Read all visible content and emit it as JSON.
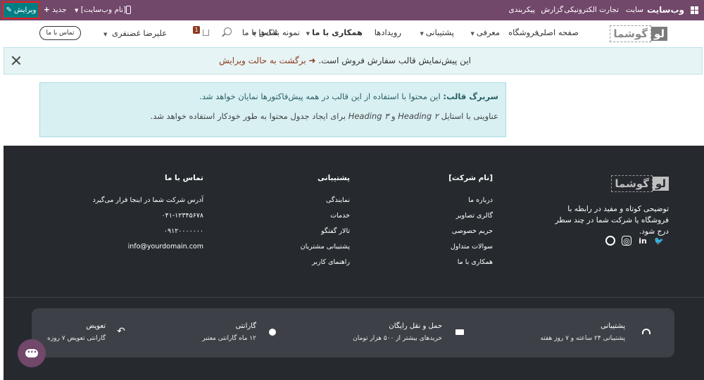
{
  "admin_bar": {
    "brand": "وب‌سایت",
    "menu": [
      "سایت",
      "تجارت الکترونیکی",
      "گزارش",
      "پیکربندی"
    ],
    "edit_label": "ویرایش",
    "new_label": "جدید",
    "site_name": "[نام وب‌سایت]"
  },
  "navbar": {
    "logo_main": "لو",
    "logo_rest": "گوشما",
    "items": [
      {
        "label": "صفحه اصلی",
        "dropdown": false
      },
      {
        "label": "فروشگاه",
        "dropdown": false
      },
      {
        "label": "معرفی",
        "dropdown": true
      },
      {
        "label": "پشتیبانی",
        "dropdown": true
      },
      {
        "label": "رویدادها",
        "dropdown": false
      },
      {
        "label": "همکاری با ما",
        "dropdown": true
      },
      {
        "label": "نمونه بلاک‌ها",
        "dropdown": true
      },
      {
        "label": "تماس با ما",
        "dropdown": false
      }
    ],
    "cart_count": "1",
    "user_name": "علیرضا غضنفری",
    "contact_button": "تماس با ما"
  },
  "preview_alert": {
    "message": "این پیش‌نمایش قالب سفارش فروش است.",
    "back_link": "برگشت به حالت ویرایش"
  },
  "info_box": {
    "title": "سربرگ قالب:",
    "line1": "این محتوا با استفاده از این قالب در همه پیش‌فاکتورها نمایان خواهد شد.",
    "line2_a": "عناوینی با استایل",
    "heading2": "Heading ۲",
    "and": "و",
    "heading3": "Heading ۳",
    "line2_b": "برای ایجاد جدول محتوا به طور خودکار استفاده خواهد شد."
  },
  "footer": {
    "logo_main": "لو",
    "logo_rest": "گوشما",
    "description": "توضیحی کوتاه و مفید در رابطه با فروشگاه یا شرکت شما در چند سطر درج شود.",
    "company_col": {
      "title": "[نام شرکت]",
      "links": [
        "درباره ما",
        "گالری تصاویر",
        "حریم خصوصی",
        "سوالات متداول",
        "همکاری با ما"
      ]
    },
    "support_col": {
      "title": "پشتیبانی",
      "links": [
        "نمایندگی",
        "خدمات",
        "تالار گفتگو",
        "پشتیبانی مشتریان",
        "راهنمای کاربر"
      ]
    },
    "contact_col": {
      "title": "تماس با ما",
      "address": "آدرس شرکت شما در اینجا قرار می‌گیرد",
      "phone": "۰۴۱-۱۲۳۴۵۶۷۸",
      "mobile": "۰۹۱۲۰۰۰۰۰۰۰",
      "email": "info@yourdomain.com"
    }
  },
  "features": [
    {
      "title": "پشتیبانی",
      "subtitle": "پشتیبانی ۲۴ ساعته و ۷ روز هفته",
      "icon": "headset-icon"
    },
    {
      "title": "حمل و نقل رایگان",
      "subtitle": "خریدهای بیشتر از ۵۰۰ هزار تومان",
      "icon": "truck-icon"
    },
    {
      "title": "گارانتی",
      "subtitle": "۱۲ ماه گارانتی معتبر",
      "icon": "badge-icon"
    },
    {
      "title": "تعویض",
      "subtitle": "گارانتی تعویض ۷ روزه",
      "icon": "reply-icon"
    }
  ]
}
